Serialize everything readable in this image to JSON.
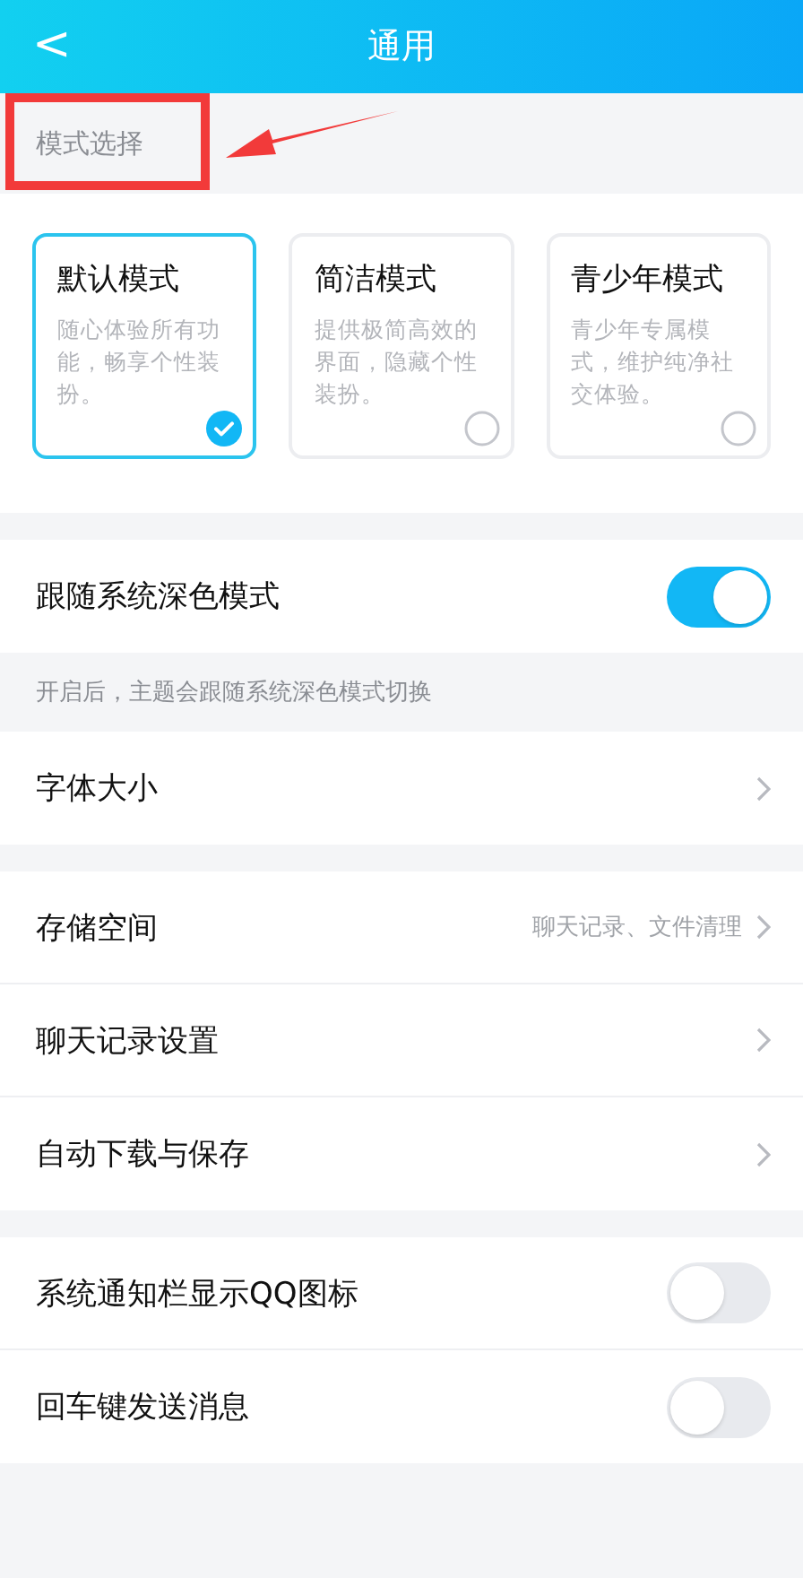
{
  "header": {
    "title": "通用",
    "back": "<"
  },
  "mode_section": {
    "label": "模式选择",
    "modes": [
      {
        "name": "默认模式",
        "description": "随心体验所有功能，畅享个性装扮。",
        "selected": true
      },
      {
        "name": "简洁模式",
        "description": "提供极简高效的界面，隐藏个性装扮。",
        "selected": false
      },
      {
        "name": "青少年模式",
        "description": "青少年专属模式，维护纯净社交体验。",
        "selected": false
      }
    ]
  },
  "groups": [
    {
      "rows": [
        {
          "kind": "toggle",
          "label": "跟随系统深色模式",
          "on": true
        }
      ],
      "hint": "开启后，主题会跟随系统深色模式切换"
    },
    {
      "rows": [
        {
          "kind": "link",
          "label": "字体大小"
        }
      ]
    },
    {
      "rows": [
        {
          "kind": "link",
          "label": "存储空间",
          "value": "聊天记录、文件清理"
        },
        {
          "kind": "link",
          "label": "聊天记录设置"
        },
        {
          "kind": "link",
          "label": "自动下载与保存"
        }
      ]
    },
    {
      "rows": [
        {
          "kind": "toggle",
          "label": "系统通知栏显示QQ图标",
          "on": false
        },
        {
          "kind": "toggle",
          "label": "回车键发送消息",
          "on": false
        }
      ]
    }
  ],
  "annotation": {
    "box": true,
    "arrow": true
  }
}
